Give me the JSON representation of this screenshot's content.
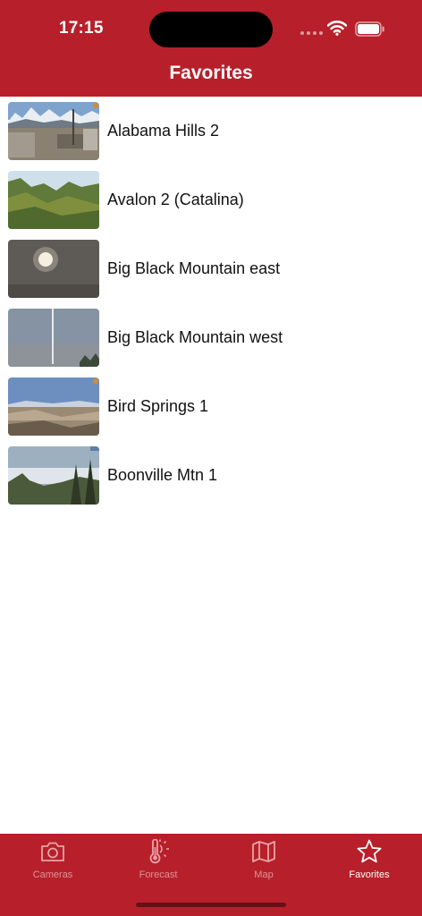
{
  "status_bar": {
    "time": "17:15"
  },
  "nav": {
    "title": "Favorites"
  },
  "favorites": [
    {
      "name": "Alabama Hills 2"
    },
    {
      "name": "Avalon 2 (Catalina)"
    },
    {
      "name": "Big Black Mountain east"
    },
    {
      "name": "Big Black Mountain west"
    },
    {
      "name": "Bird Springs 1"
    },
    {
      "name": "Boonville Mtn 1"
    }
  ],
  "tabbar": {
    "tabs": [
      {
        "label": "Cameras",
        "icon": "camera-icon"
      },
      {
        "label": "Forecast",
        "icon": "thermometer-sun-icon"
      },
      {
        "label": "Map",
        "icon": "map-icon"
      },
      {
        "label": "Favorites",
        "icon": "star-icon"
      }
    ],
    "active_tab": "Favorites"
  },
  "colors": {
    "brand": "#b7202a",
    "inactive_tab": "#e8a3a7",
    "active_tab": "#ffffff"
  }
}
